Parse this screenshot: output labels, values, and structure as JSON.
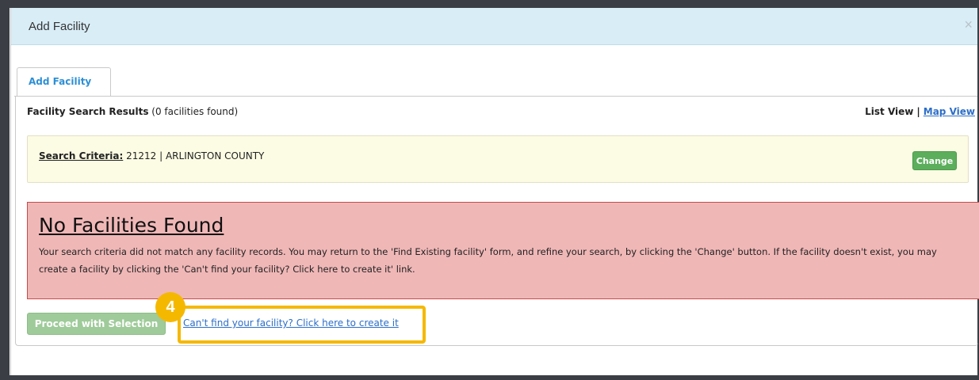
{
  "modal": {
    "title": "Add Facility",
    "close_glyph": "×"
  },
  "tabs": [
    {
      "label": "Add Facility",
      "active": true
    }
  ],
  "results": {
    "heading": "Facility Search Results",
    "count_text": "(0 facilities found)",
    "views": {
      "list": "List View",
      "separator": "|",
      "map": "Map View"
    }
  },
  "criteria": {
    "label": "Search Criteria:",
    "value": "21212 | ARLINGTON COUNTY",
    "change_button": "Change"
  },
  "alert": {
    "title": "No Facilities Found",
    "body": "Your search criteria did not match any facility records. You may return to the 'Find Existing facility' form, and refine your search, by clicking the 'Change' button. If the facility doesn't exist, you may create a facility by clicking the 'Can't find your facility? Click here to create it' link."
  },
  "actions": {
    "proceed_button": "Proceed with Selection",
    "create_link": "Can't find your facility? Click here to create it"
  },
  "annotation": {
    "step_number": "4"
  },
  "colors": {
    "header_bg": "#d9edf7",
    "tab_label": "#2d8fd5",
    "link": "#2d6ec7",
    "criteria_bg": "#fcfbe3",
    "alert_bg": "#f0b7b7",
    "alert_border": "#c74a4a",
    "success": "#5cae5c",
    "highlight": "#f5b800"
  },
  "icons": {
    "close": "close-icon"
  }
}
